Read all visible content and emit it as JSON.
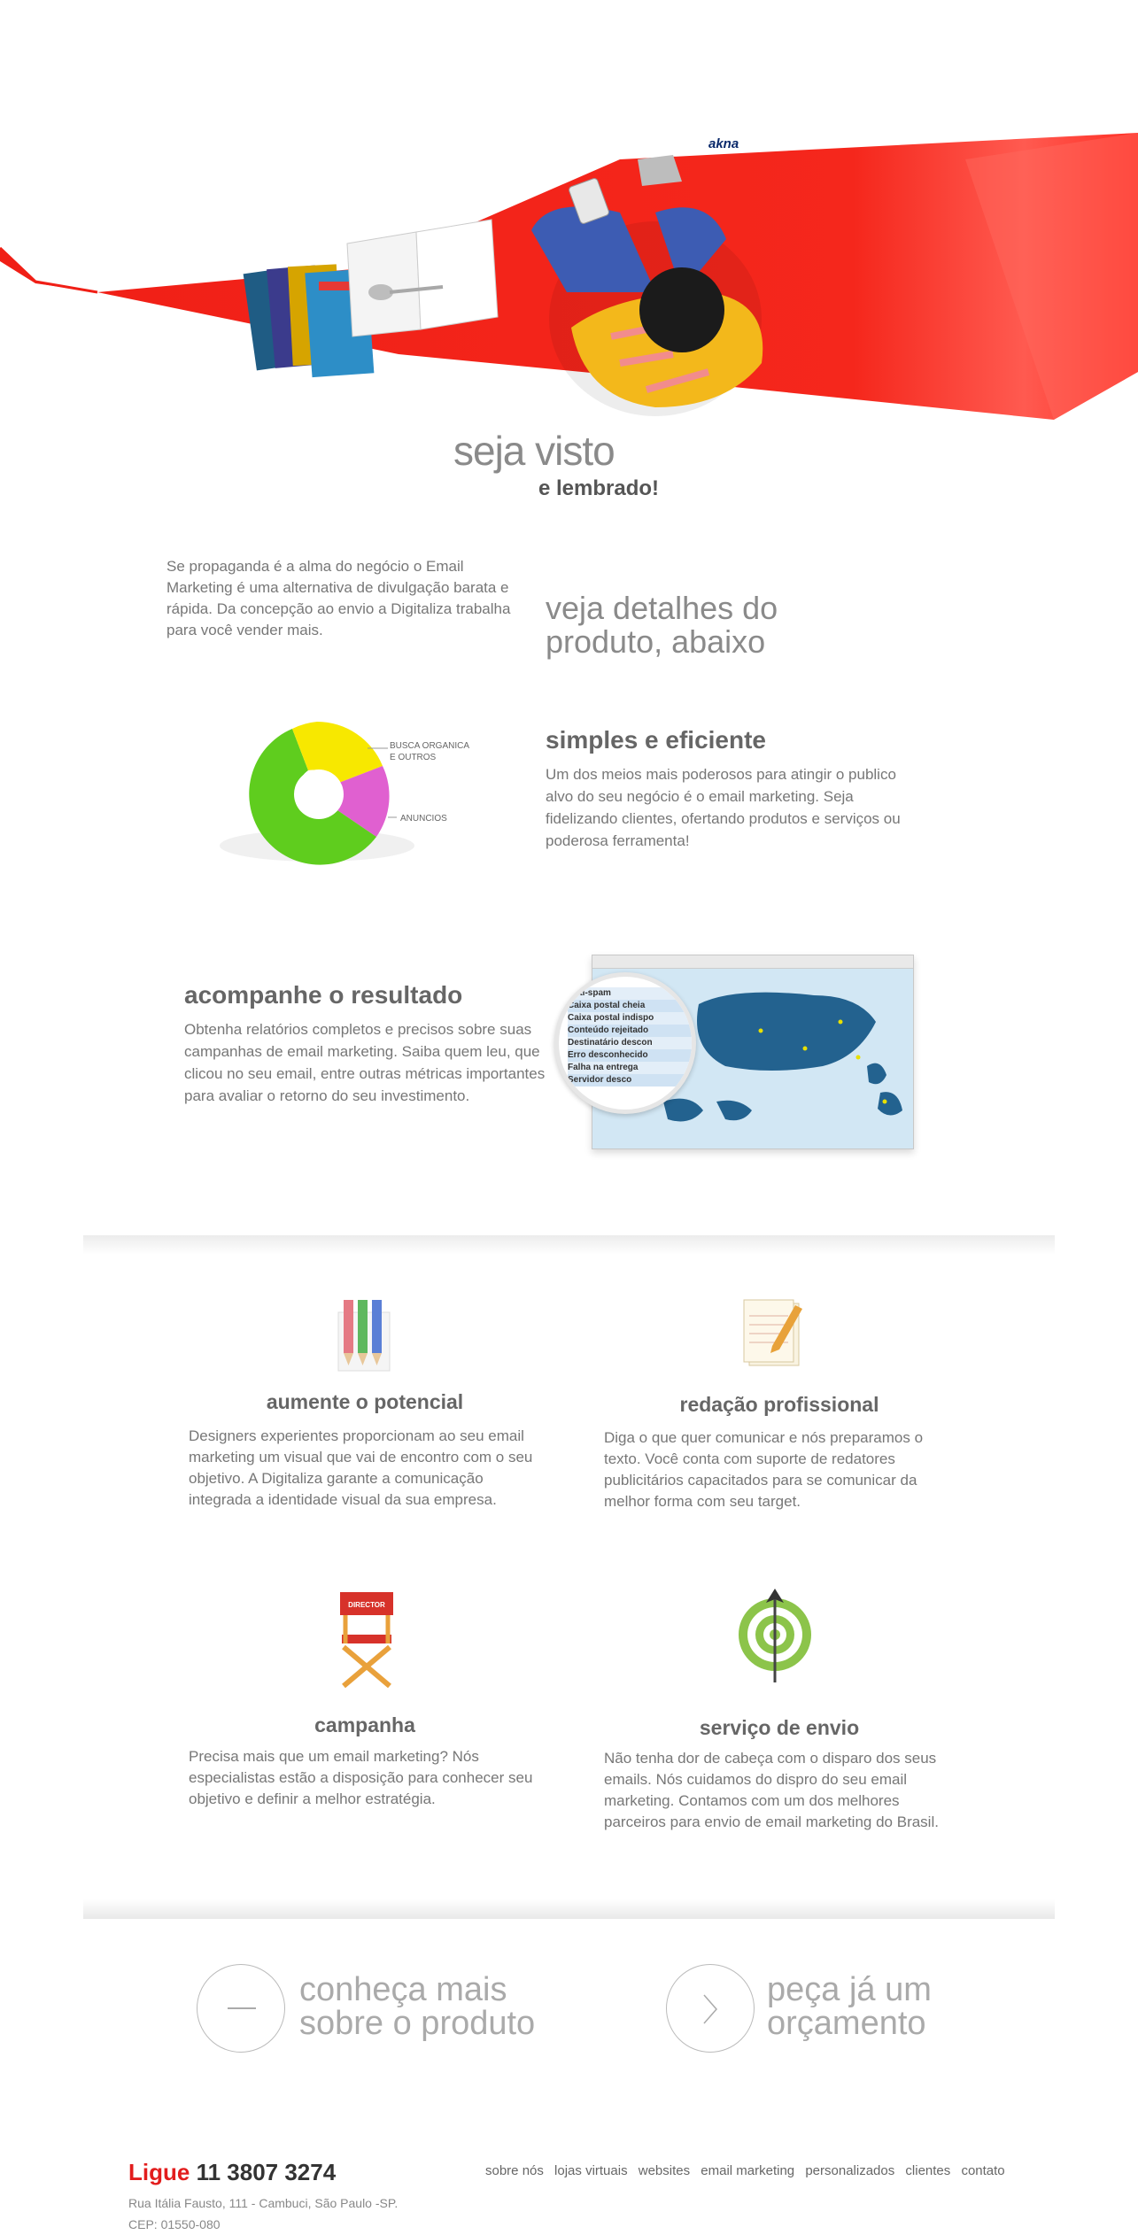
{
  "hero": {
    "brand": "akna",
    "title": "seja visto",
    "subtitle": "e lembrado!",
    "accent": "#f01f16"
  },
  "intro": {
    "text": "Se propaganda é a alma do negócio o Email Marketing é uma alternativa de divulgação barata e rápida. Da concepção ao envio a Digitaliza trabalha para você vender mais.",
    "details": "veja detalhes do produto, abaixo"
  },
  "simples": {
    "title": "simples e eficiente",
    "text": "Um dos meios mais poderosos para atingir o publico alvo do seu negócio é o email marketing. Seja fidelizando clientes, ofertando produtos e serviços ou poderosa ferramenta!",
    "pie_labels": [
      "BUSCA ORGANICA",
      "E OUTROS",
      "ANUNCIOS"
    ]
  },
  "resultado": {
    "title": "acompanhe o resultado",
    "text": "Obtenha relatórios completos e precisos sobre suas campanhas de email marketing. Saiba quem leu, que clicou no seu email, entre outras métricas importantes para avaliar o retorno do seu investimento.",
    "report_items": [
      "Anti-spam",
      "Caixa postal cheia",
      "Caixa postal indispo",
      "Conteúdo rejeitado",
      "Destinatário descon",
      "Erro desconhecido",
      "Falha na entrega",
      "Servidor desco"
    ]
  },
  "features": [
    {
      "title": "aumente o potencial",
      "text": "Designers experientes proporcionam ao seu email marketing um visual que vai de encontro com o seu objetivo. A Digitaliza garante a comunicação integrada a identidade visual da sua empresa.",
      "icon": "pencils-icon"
    },
    {
      "title": "redação profissional",
      "text": "Diga o que quer comunicar e nós preparamos o texto. Você conta com suporte de redatores publicitários capacitados para se comunicar da melhor forma com seu target.",
      "icon": "notepad-icon"
    },
    {
      "title": "campanha",
      "text": "Precisa mais que um email marketing? Nós especialistas estão a disposição para conhecer seu objetivo e definir a melhor estratégia.",
      "icon": "director-chair-icon",
      "chair_label": "DIRECTOR"
    },
    {
      "title": "serviço de envio",
      "text": "Não tenha dor de cabeça com o disparo dos seus emails. Nós cuidamos do dispro do seu email marketing. Contamos com um dos melhores parceiros para envio de email marketing do Brasil.",
      "icon": "target-icon"
    }
  ],
  "cta": {
    "more_line1": "conheça mais",
    "more_line2": "sobre o produto",
    "quote_line1": "peça já um",
    "quote_line2": "orçamento"
  },
  "footer": {
    "ligue": "Ligue",
    "phone": "11 3807 3274",
    "address": "Rua Itália Fausto, 111 - Cambuci, São Paulo -SP.",
    "cep": "CEP: 01550-080",
    "nav": [
      "sobre nós",
      "lojas virtuais",
      "websites",
      "email marketing",
      "personalizados",
      "clientes",
      "contato"
    ]
  }
}
